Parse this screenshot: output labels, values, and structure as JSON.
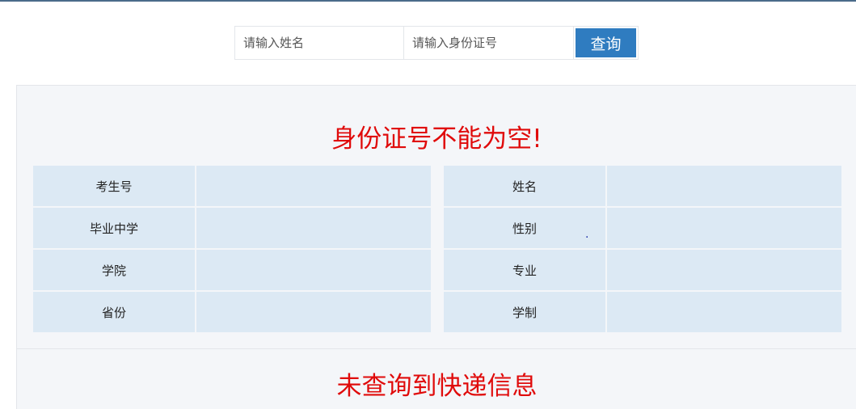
{
  "search": {
    "name_placeholder": "请输入姓名",
    "id_placeholder": "请输入身份证号",
    "query_label": "查询"
  },
  "result": {
    "error_message": "身份证号不能为空!",
    "left_fields": [
      {
        "label": "考生号",
        "value": ""
      },
      {
        "label": "毕业中学",
        "value": ""
      },
      {
        "label": "学院",
        "value": ""
      },
      {
        "label": "省份",
        "value": ""
      }
    ],
    "right_fields": [
      {
        "label": "姓名",
        "value": ""
      },
      {
        "label": "性别",
        "value": ""
      },
      {
        "label": "专业",
        "value": ""
      },
      {
        "label": "学制",
        "value": ""
      }
    ],
    "stray_mark": "."
  },
  "express": {
    "message": "未查询到快递信息"
  },
  "colors": {
    "accent": "#2f7cc0",
    "error": "#e00b0b",
    "cell_bg": "#dce9f4",
    "panel_bg": "#f4f6f9"
  }
}
